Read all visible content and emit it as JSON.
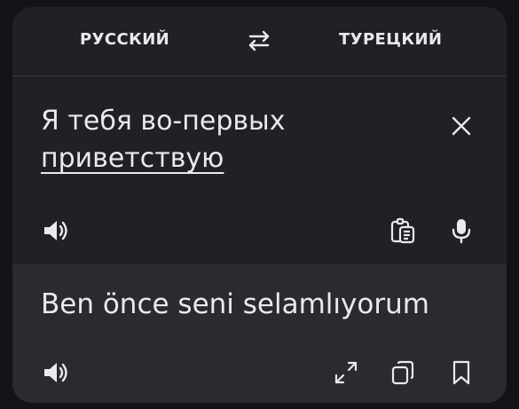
{
  "header": {
    "source_language": "РУССКИЙ",
    "target_language": "ТУРЕЦКИЙ",
    "swap_icon": "swap-arrows-icon"
  },
  "input": {
    "text_part1": "Я тебя во-первых ",
    "text_part2_underlined": "приветствую",
    "icons": [
      "clear-icon",
      "speaker-icon",
      "paste-clipboard-icon",
      "microphone-icon"
    ]
  },
  "output": {
    "text": "Ben önce seni selamlıyorum",
    "icons": [
      "speaker-icon",
      "fullscreen-icon",
      "copy-icon",
      "bookmark-icon"
    ]
  },
  "colors": {
    "background": "#121316",
    "card": "#202124",
    "output_panel": "#2a2b2f",
    "text": "#e8eaed"
  }
}
